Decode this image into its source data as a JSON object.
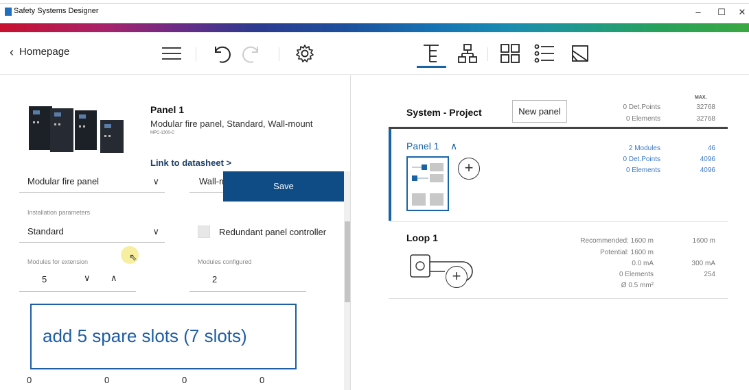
{
  "window": {
    "title": "Safety Systems Designer",
    "minimize": "–",
    "maximize": "☐",
    "close": "✕"
  },
  "toolbar": {
    "back_label": "Homepage"
  },
  "left": {
    "panel_name": "Panel 1",
    "panel_description": "Modular fire panel, Standard, Wall-mount",
    "panel_code": "MPC-1300-C",
    "datasheet_link": "Link to datasheet >",
    "panel_type_value": "Modular fire panel",
    "mount_value": "Wall-m",
    "save_label": "Save",
    "installation_caption": "Installation parameters",
    "installation_value": "Standard",
    "redundant_label": "Redundant panel controller",
    "modules_ext_caption": "Modules for extension",
    "modules_ext_value": "5",
    "modules_conf_caption": "Modules configured",
    "modules_conf_value": "2",
    "overlay_text": "add 5 spare slots (7 slots)",
    "bottom_values": [
      "0",
      "0",
      "0",
      "0"
    ]
  },
  "right": {
    "system_title": "System - Project",
    "new_panel_label": "New panel",
    "max_label": "MAX.",
    "system_stats": [
      {
        "label": "0 Det.Points",
        "max": "32768"
      },
      {
        "label": "0 Elements",
        "max": "32768"
      }
    ],
    "panel": {
      "name": "Panel 1",
      "stats": [
        {
          "label": "2 Modules",
          "max": "46"
        },
        {
          "label": "0 Det.Points",
          "max": "4096"
        },
        {
          "label": "0 Elements",
          "max": "4096"
        }
      ]
    },
    "loop": {
      "name": "Loop 1",
      "stats": [
        {
          "label": "Recommended: 1600 m",
          "max": "1600 m"
        },
        {
          "label": "Potential: 1600 m",
          "max": ""
        },
        {
          "label": "0.0 mA",
          "max": "300 mA"
        },
        {
          "label": "0 Elements",
          "max": "254"
        },
        {
          "label": "Ø 0.5 mm²",
          "max": ""
        }
      ]
    }
  },
  "colors": {
    "primary_blue": "#1863a6",
    "save_button": "#0f4c86",
    "overlay_border": "#1d5ea4"
  },
  "icons": [
    "chevron-left-icon",
    "menu-icon",
    "undo-icon",
    "redo-icon",
    "settings-icon",
    "tree-view-icon",
    "network-view-icon",
    "grid-view-icon",
    "list-view-icon",
    "image-view-icon"
  ]
}
